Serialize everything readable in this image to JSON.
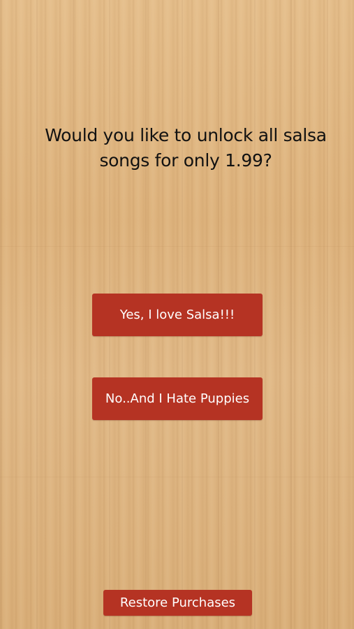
{
  "purchase_prompt": {
    "question": "Would you like to unlock all salsa songs for only 1.99?",
    "accept_label": "Yes, I love Salsa!!!",
    "decline_label": "No..And I Hate Puppies",
    "restore_label": "Restore Purchases"
  },
  "colors": {
    "button_background": "#b53323",
    "button_text": "#ffffff",
    "prompt_text": "#111111",
    "wood_background": "#e1b884"
  }
}
